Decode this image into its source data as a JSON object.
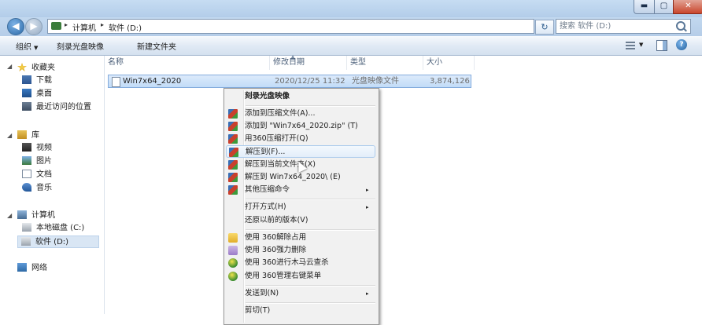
{
  "window_controls": {
    "minimize": "▬",
    "maximize": "▢",
    "close": "✕"
  },
  "address_bar": {
    "crumbs": [
      "计算机",
      "软件 (D:)"
    ],
    "separator": "▸"
  },
  "search": {
    "placeholder": "搜索 软件 (D:)"
  },
  "toolbar": {
    "organize": "组织",
    "burn": "刻录光盘映像",
    "new_folder": "新建文件夹"
  },
  "nav": {
    "favorites": "收藏夹",
    "downloads": "下载",
    "desktop": "桌面",
    "recent": "最近访问的位置",
    "libraries": "库",
    "videos": "视频",
    "pictures": "图片",
    "documents": "文档",
    "music": "音乐",
    "computer": "计算机",
    "drive_c": "本地磁盘 (C:)",
    "drive_d": "软件 (D:)",
    "network": "网络"
  },
  "columns": {
    "name": "名称",
    "modified": "修改日期",
    "type": "类型",
    "size": "大小"
  },
  "file": {
    "name": "Win7x64_2020",
    "modified": "2020/12/25 11:32",
    "type": "光盘映像文件",
    "size": "3,874,126"
  },
  "context_menu": {
    "burn": "刻录光盘映像",
    "add_archive": "添加到压缩文件(A)...",
    "add_zip": "添加到 \"Win7x64_2020.zip\" (T)",
    "open_360": "用360压缩打开(Q)",
    "extract_to": "解压到(F)...",
    "extract_here": "解压到当前文件夹(X)",
    "extract_folder": "解压到 Win7x64_2020\\ (E)",
    "more": "其他压缩命令",
    "open_with": "打开方式(H)",
    "restore": "还原以前的版本(V)",
    "unlock_360": "使用 360解除占用",
    "shred_360": "使用 360强力删除",
    "scan_360": "使用 360进行木马云查杀",
    "manage_360": "使用 360管理右键菜单",
    "send_to": "发送到(N)",
    "cut": "剪切(T)",
    "submenu_arrow": "▸"
  },
  "colors": {
    "selection": "#cce0f7",
    "menu_bg": "#f1f1f1",
    "titlebar": "#c6dcf2"
  }
}
